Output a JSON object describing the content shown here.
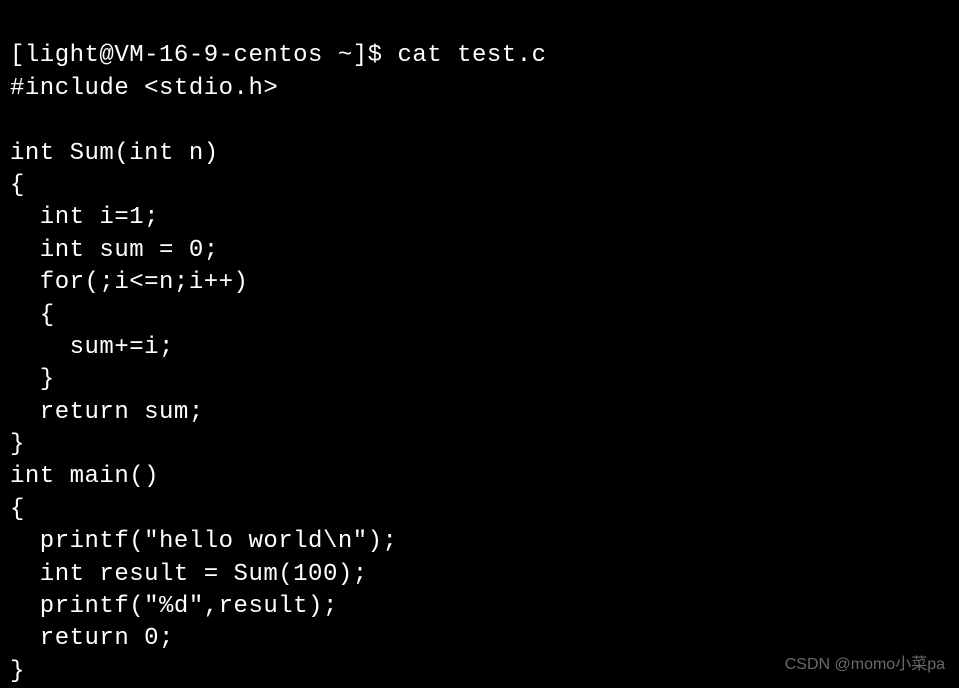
{
  "terminal": {
    "prompt": "[light@VM-16-9-centos ~]$ ",
    "command": "cat test.c",
    "lines": [
      "#include <stdio.h>",
      "",
      "int Sum(int n)",
      "{",
      "  int i=1;",
      "  int sum = 0;",
      "  for(;i<=n;i++)",
      "  {",
      "    sum+=i;",
      "  }",
      "  return sum;",
      "}",
      "int main()",
      "{",
      "  printf(\"hello world\\n\");",
      "  int result = Sum(100);",
      "  printf(\"%d\",result);",
      "  return 0;",
      "}"
    ]
  },
  "watermark": "CSDN @momo小菜pa"
}
